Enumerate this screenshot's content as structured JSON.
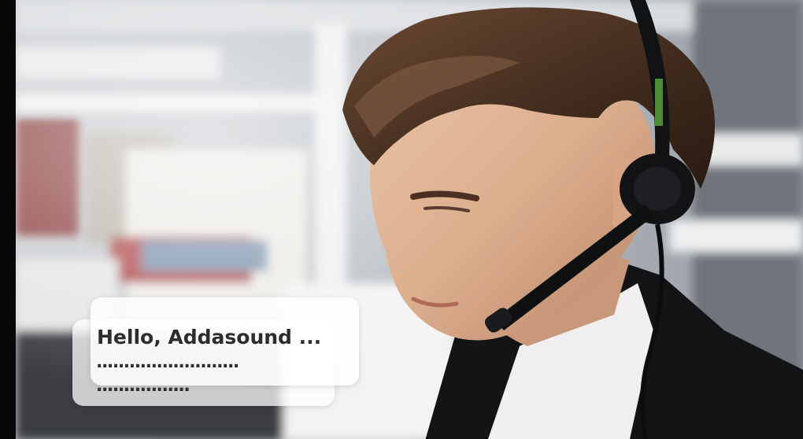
{
  "bubble": {
    "greeting": "Hello, Addasound ...",
    "typing_line_1": "..........................",
    "typing_line_2": "................."
  },
  "photo": {
    "icon": "person-with-headset-photo"
  }
}
